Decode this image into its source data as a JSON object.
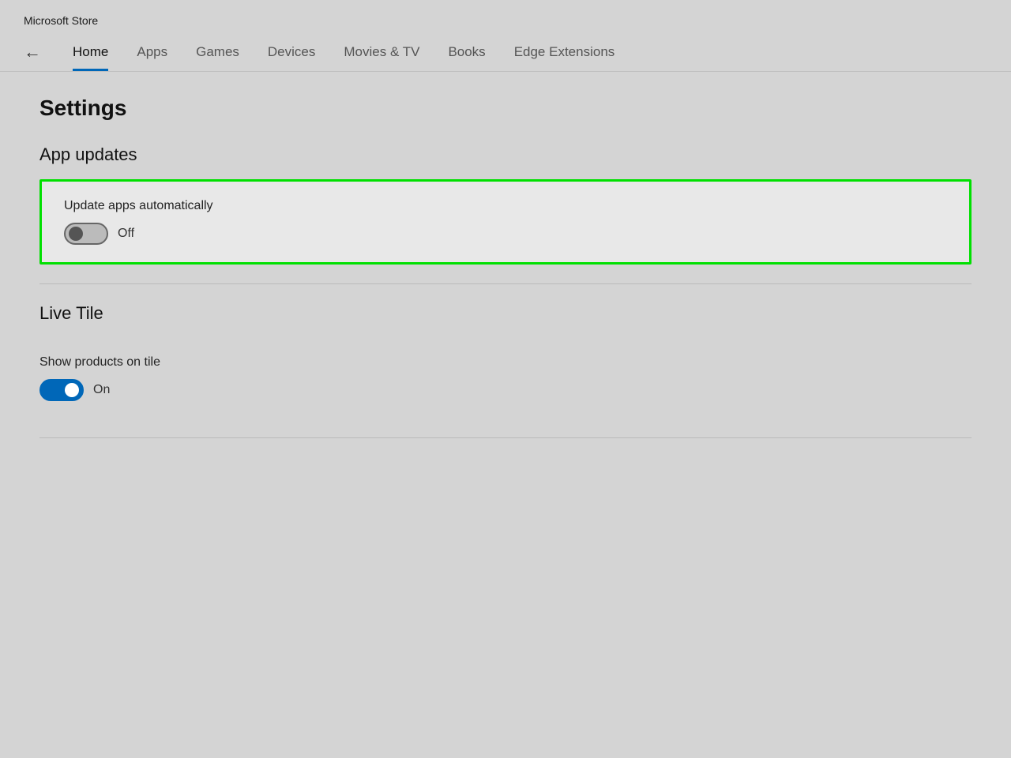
{
  "titleBar": {
    "label": "Microsoft Store"
  },
  "nav": {
    "backArrow": "←",
    "items": [
      {
        "id": "home",
        "label": "Home",
        "active": true
      },
      {
        "id": "apps",
        "label": "Apps",
        "active": false
      },
      {
        "id": "games",
        "label": "Games",
        "active": false
      },
      {
        "id": "devices",
        "label": "Devices",
        "active": false
      },
      {
        "id": "movies-tv",
        "label": "Movies & TV",
        "active": false
      },
      {
        "id": "books",
        "label": "Books",
        "active": false
      },
      {
        "id": "edge-extensions",
        "label": "Edge Extensions",
        "active": false
      }
    ]
  },
  "page": {
    "title": "Settings"
  },
  "sections": [
    {
      "id": "app-updates",
      "title": "App updates",
      "settings": [
        {
          "id": "update-apps-automatically",
          "label": "Update apps automatically",
          "toggleState": "off",
          "stateLabel": "Off",
          "highlighted": true
        }
      ]
    },
    {
      "id": "live-tile",
      "title": "Live Tile",
      "settings": [
        {
          "id": "show-products-on-tile",
          "label": "Show products on tile",
          "toggleState": "on",
          "stateLabel": "On",
          "highlighted": false
        }
      ]
    }
  ]
}
